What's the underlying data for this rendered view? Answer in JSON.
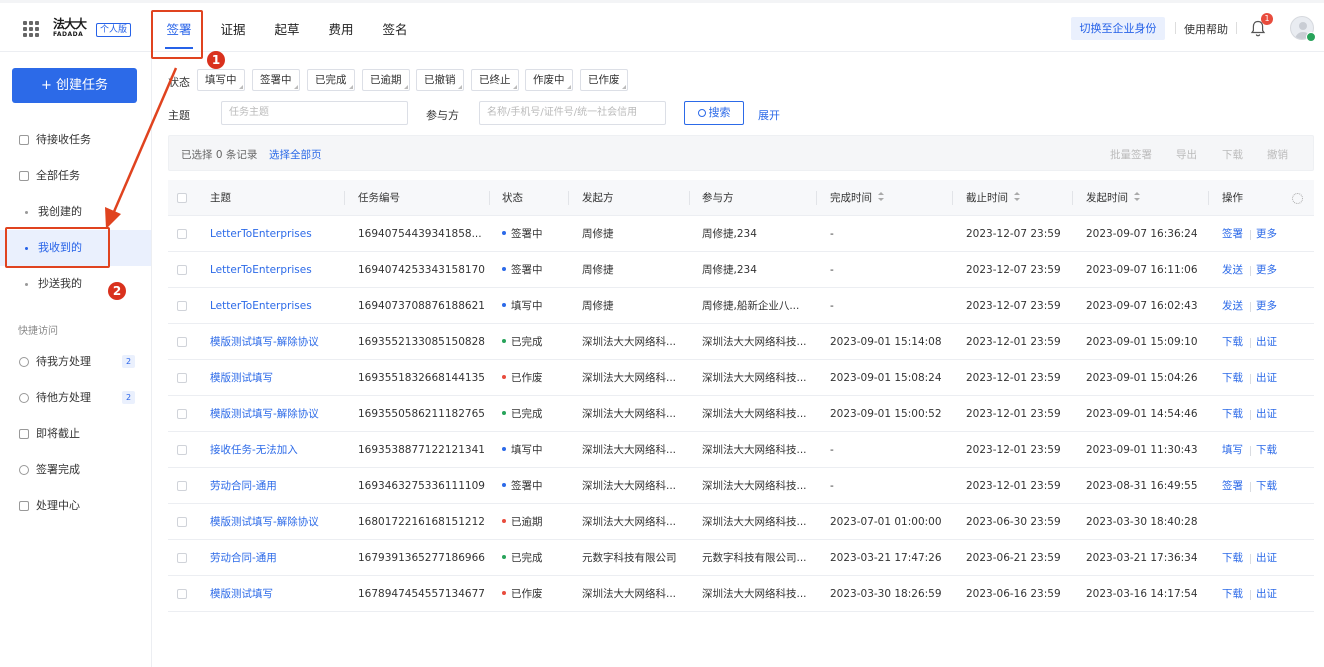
{
  "header": {
    "logo_text": "法大大",
    "logo_sub": "FADADA",
    "edition": "个人版",
    "tabs": [
      {
        "label": "签署"
      },
      {
        "label": "证据"
      },
      {
        "label": "起草"
      },
      {
        "label": "费用"
      },
      {
        "label": "签名"
      }
    ],
    "switch_label": "切换至企业身份",
    "help_label": "使用帮助",
    "notification_count": "1"
  },
  "sidebar": {
    "create_label": "+ 创建任务",
    "items": [
      {
        "label": "待接收任务"
      },
      {
        "label": "全部任务"
      },
      {
        "label": "我创建的"
      },
      {
        "label": "我收到的"
      },
      {
        "label": "抄送我的"
      }
    ],
    "quick_title": "快捷访问",
    "quick": [
      {
        "label": "待我方处理",
        "count": "2"
      },
      {
        "label": "待他方处理",
        "count": "2"
      },
      {
        "label": "即将截止"
      },
      {
        "label": "签署完成"
      },
      {
        "label": "处理中心"
      }
    ]
  },
  "annotations": {
    "one": "1",
    "two": "2",
    "color": "#e0431f"
  },
  "filters": {
    "status_label": "状态",
    "statuses": [
      "填写中",
      "签署中",
      "已完成",
      "已逾期",
      "已撤销",
      "已终止",
      "作废中",
      "已作废"
    ],
    "subject_label": "主题",
    "subject_placeholder": "任务主题",
    "party_label": "参与方",
    "party_placeholder": "名称/手机号/证件号/统一社会信用",
    "search_label": "搜索",
    "expand_label": "展开"
  },
  "selection": {
    "info": "已选择 0 条记录",
    "select_all": "选择全部页",
    "actions": [
      "批量签署",
      "导出",
      "下载",
      "撤销"
    ]
  },
  "table": {
    "columns": [
      "主题",
      "任务编号",
      "状态",
      "发起方",
      "参与方",
      "完成时间",
      "截止时间",
      "发起时间",
      "操作"
    ],
    "rows": [
      {
        "subject": "LetterToEnterprises",
        "id": "16940754439341858...",
        "status": "签署中",
        "status_color": "#2c6ae8",
        "initiator": "周修捷",
        "party": "周修捷,234",
        "done": "-",
        "deadline": "2023-12-07 23:59",
        "started": "2023-09-07 16:36:24",
        "ops": [
          "签署",
          "更多"
        ]
      },
      {
        "subject": "LetterToEnterprises",
        "id": "1694074253343158170",
        "status": "签署中",
        "status_color": "#2c6ae8",
        "initiator": "周修捷",
        "party": "周修捷,234",
        "done": "-",
        "deadline": "2023-12-07 23:59",
        "started": "2023-09-07 16:11:06",
        "ops": [
          "发送",
          "更多"
        ]
      },
      {
        "subject": "LetterToEnterprises",
        "id": "1694073708876188621",
        "status": "填写中",
        "status_color": "#2c6ae8",
        "initiator": "周修捷",
        "party": "周修捷,船新企业八...",
        "done": "-",
        "deadline": "2023-12-07 23:59",
        "started": "2023-09-07 16:02:43",
        "ops": [
          "发送",
          "更多"
        ]
      },
      {
        "subject": "模版测试填写-解除协议",
        "id": "1693552133085150828",
        "status": "已完成",
        "status_color": "#27a35a",
        "initiator": "深圳法大大网络科...",
        "party": "深圳法大大网络科技...",
        "done": "2023-09-01 15:14:08",
        "deadline": "2023-12-01 23:59",
        "started": "2023-09-01 15:09:10",
        "ops": [
          "下载",
          "出证"
        ]
      },
      {
        "subject": "模版测试填写",
        "id": "1693551832668144135",
        "status": "已作废",
        "status_color": "#e84c3d",
        "initiator": "深圳法大大网络科...",
        "party": "深圳法大大网络科技...",
        "done": "2023-09-01 15:08:24",
        "deadline": "2023-12-01 23:59",
        "started": "2023-09-01 15:04:26",
        "ops": [
          "下载",
          "出证"
        ]
      },
      {
        "subject": "模版测试填写-解除协议",
        "id": "1693550586211182765",
        "status": "已完成",
        "status_color": "#27a35a",
        "initiator": "深圳法大大网络科...",
        "party": "深圳法大大网络科技...",
        "done": "2023-09-01 15:00:52",
        "deadline": "2023-12-01 23:59",
        "started": "2023-09-01 14:54:46",
        "ops": [
          "下载",
          "出证"
        ]
      },
      {
        "subject": "接收任务-无法加入",
        "id": "1693538877122121341",
        "status": "填写中",
        "status_color": "#2c6ae8",
        "initiator": "深圳法大大网络科...",
        "party": "深圳法大大网络科技...",
        "done": "-",
        "deadline": "2023-12-01 23:59",
        "started": "2023-09-01 11:30:43",
        "ops": [
          "填写",
          "下载"
        ]
      },
      {
        "subject": "劳动合同-通用",
        "id": "1693463275336111109",
        "status": "签署中",
        "status_color": "#2c6ae8",
        "initiator": "深圳法大大网络科...",
        "party": "深圳法大大网络科技...",
        "done": "-",
        "deadline": "2023-12-01 23:59",
        "started": "2023-08-31 16:49:55",
        "ops": [
          "签署",
          "下载"
        ]
      },
      {
        "subject": "模版测试填写-解除协议",
        "id": "1680172216168151212",
        "status": "已逾期",
        "status_color": "#e84c3d",
        "initiator": "深圳法大大网络科...",
        "party": "深圳法大大网络科技...",
        "done": "2023-07-01 01:00:00",
        "deadline": "2023-06-30 23:59",
        "started": "2023-03-30 18:40:28",
        "ops": []
      },
      {
        "subject": "劳动合同-通用",
        "id": "1679391365277186966",
        "status": "已完成",
        "status_color": "#27a35a",
        "initiator": "元数字科技有限公司",
        "party": "元数字科技有限公司...",
        "done": "2023-03-21 17:47:26",
        "deadline": "2023-06-21 23:59",
        "started": "2023-03-21 17:36:34",
        "ops": [
          "下载",
          "出证"
        ]
      },
      {
        "subject": "模版测试填写",
        "id": "1678947454557134677",
        "status": "已作废",
        "status_color": "#e84c3d",
        "initiator": "深圳法大大网络科...",
        "party": "深圳法大大网络科技...",
        "done": "2023-03-30 18:26:59",
        "deadline": "2023-06-16 23:59",
        "started": "2023-03-16 14:17:54",
        "ops": [
          "下载",
          "出证"
        ]
      }
    ]
  }
}
